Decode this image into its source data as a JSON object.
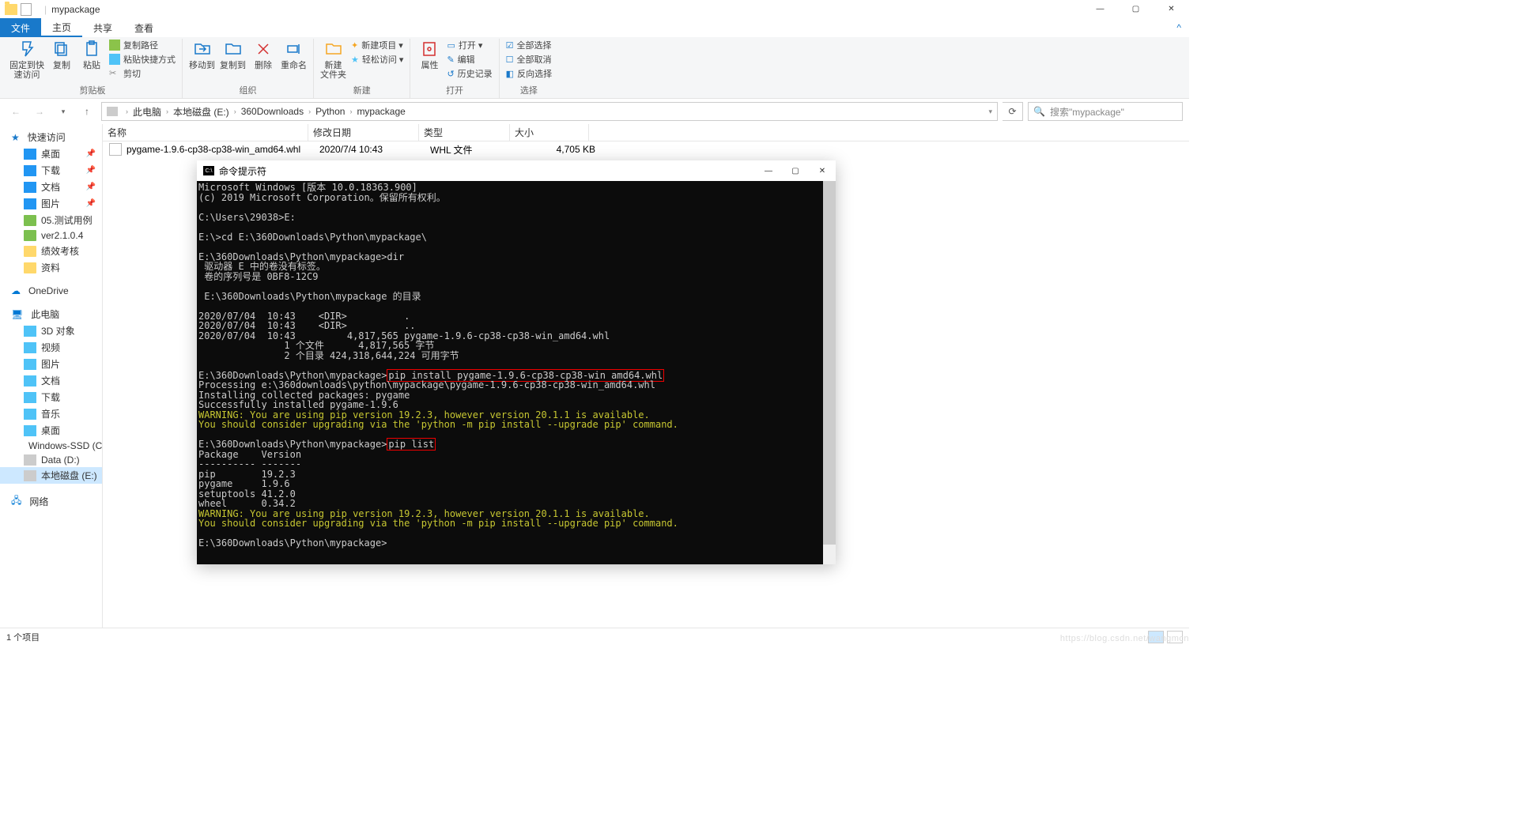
{
  "window": {
    "title": "mypackage",
    "min": "—",
    "max": "▢",
    "close": "✕"
  },
  "tabs": {
    "file": "文件",
    "home": "主页",
    "share": "共享",
    "view": "查看"
  },
  "ribbon": {
    "pin": "固定到快\n速访问",
    "copy": "复制",
    "paste": "粘贴",
    "copypath": "复制路径",
    "pasteshortcut": "粘贴快捷方式",
    "cut": "剪切",
    "g1": "剪贴板",
    "moveto": "移动到",
    "copyto": "复制到",
    "delete": "删除",
    "rename": "重命名",
    "g2": "组织",
    "newfolder": "新建\n文件夹",
    "newitem": "新建项目 ▾",
    "easyaccess": "轻松访问 ▾",
    "g3": "新建",
    "props": "属性",
    "open": "打开 ▾",
    "edit": "编辑",
    "history": "历史记录",
    "g4": "打开",
    "selall": "全部选择",
    "selnone": "全部取消",
    "invsel": "反向选择",
    "g5": "选择"
  },
  "breadcrumb": {
    "p0": "此电脑",
    "p1": "本地磁盘 (E:)",
    "p2": "360Downloads",
    "p3": "Python",
    "p4": "mypackage",
    "search_ph": "搜索\"mypackage\""
  },
  "columns": {
    "name": "名称",
    "date": "修改日期",
    "type": "类型",
    "size": "大小"
  },
  "filerow": {
    "name": "pygame-1.9.6-cp38-cp38-win_amd64.whl",
    "date": "2020/7/4 10:43",
    "type": "WHL 文件",
    "size": "4,705 KB"
  },
  "sidebar": {
    "quick": "快速访问",
    "items1": [
      "桌面",
      "下载",
      "文档",
      "图片",
      "05.测试用例",
      "ver2.1.0.4",
      "绩效考核",
      "资料"
    ],
    "onedrive": "OneDrive",
    "thispc": "此电脑",
    "items2": [
      "3D 对象",
      "视频",
      "图片",
      "文档",
      "下载",
      "音乐",
      "桌面",
      "Windows-SSD (C:",
      "Data (D:)",
      "本地磁盘 (E:)"
    ],
    "network": "网络"
  },
  "status": {
    "count": "1 个项目"
  },
  "cmd": {
    "title": "命令提示符",
    "lines": {
      "l1": "Microsoft Windows [版本 10.0.18363.900]",
      "l2": "(c) 2019 Microsoft Corporation。保留所有权利。",
      "l3": "C:\\Users\\29038>E:",
      "l4": "E:\\>cd E:\\360Downloads\\Python\\mypackage\\",
      "l5": "E:\\360Downloads\\Python\\mypackage>dir",
      "l6": " 驱动器 E 中的卷没有标签。",
      "l7": " 卷的序列号是 0BF8-12C9",
      "l8": " E:\\360Downloads\\Python\\mypackage 的目录",
      "l9": "2020/07/04  10:43    <DIR>          .",
      "l10": "2020/07/04  10:43    <DIR>          ..",
      "l11": "2020/07/04  10:43         4,817,565 pygame-1.9.6-cp38-cp38-win_amd64.whl",
      "l12": "               1 个文件      4,817,565 字节",
      "l13": "               2 个目录 424,318,644,224 可用字节",
      "p1a": "E:\\360Downloads\\Python\\mypackage>",
      "p1b": "pip install pygame-1.9.6-cp38-cp38-win amd64.whl",
      "l14": "Processing e:\\360downloads\\python\\mypackage\\pygame-1.9.6-cp38-cp38-win_amd64.whl",
      "l15": "Installing collected packages: pygame",
      "l16": "Successfully installed pygame-1.9.6",
      "w1": "WARNING: You are using pip version 19.2.3, however version 20.1.1 is available.",
      "w2": "You should consider upgrading via the 'python -m pip install --upgrade pip' command.",
      "p2a": "E:\\360Downloads\\Python\\mypackage>",
      "p2b": "pip list",
      "l17": "Package    Version",
      "l18": "---------- -------",
      "l19": "pip        19.2.3",
      "l20": "pygame     1.9.6",
      "l21": "setuptools 41.2.0",
      "l22": "wheel      0.34.2",
      "l23": "E:\\360Downloads\\Python\\mypackage>"
    }
  },
  "watermark": "https://blog.csdn.net/wangmcn"
}
